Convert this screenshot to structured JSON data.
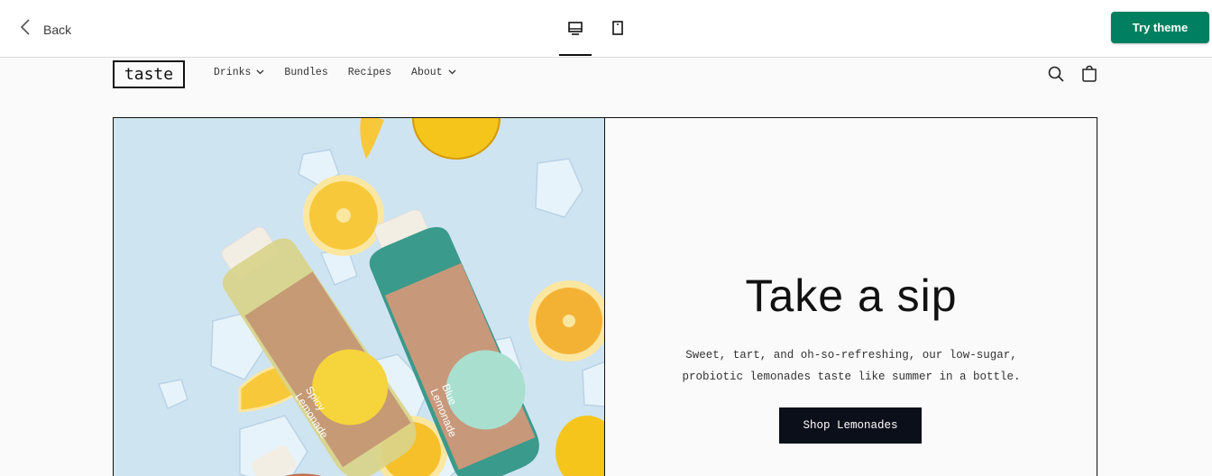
{
  "topbar": {
    "back_label": "Back",
    "try_label": "Try theme",
    "icons": [
      "chevron-left-icon",
      "desktop-icon",
      "mobile-icon"
    ],
    "accent_color": "#008060"
  },
  "store": {
    "logo": "taste",
    "nav": [
      {
        "label": "Drinks",
        "has_dropdown": true
      },
      {
        "label": "Bundles",
        "has_dropdown": false
      },
      {
        "label": "Recipes",
        "has_dropdown": false
      },
      {
        "label": "About",
        "has_dropdown": true
      }
    ],
    "icons": [
      "search-icon",
      "cart-icon"
    ]
  },
  "hero": {
    "title": "Take a sip",
    "description_line1": "Sweet, tart, and oh-so-refreshing, our low-sugar,",
    "description_line2": "probiotic lemonades taste like summer in a bottle.",
    "button_label": "Shop Lemonades",
    "bottle_labels": [
      {
        "line1": "Spicy",
        "line2": "Lemonade"
      },
      {
        "line1": "Blue",
        "line2": "Lemonade"
      }
    ]
  }
}
